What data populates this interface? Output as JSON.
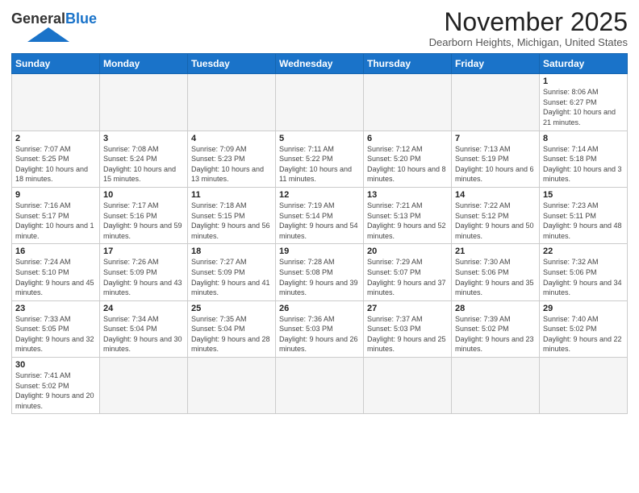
{
  "logo": {
    "general": "General",
    "blue": "Blue"
  },
  "title": "November 2025",
  "location": "Dearborn Heights, Michigan, United States",
  "weekdays": [
    "Sunday",
    "Monday",
    "Tuesday",
    "Wednesday",
    "Thursday",
    "Friday",
    "Saturday"
  ],
  "weeks": [
    [
      {
        "day": "",
        "info": ""
      },
      {
        "day": "",
        "info": ""
      },
      {
        "day": "",
        "info": ""
      },
      {
        "day": "",
        "info": ""
      },
      {
        "day": "",
        "info": ""
      },
      {
        "day": "",
        "info": ""
      },
      {
        "day": "1",
        "info": "Sunrise: 8:06 AM\nSunset: 6:27 PM\nDaylight: 10 hours and 21 minutes."
      }
    ],
    [
      {
        "day": "2",
        "info": "Sunrise: 7:07 AM\nSunset: 5:25 PM\nDaylight: 10 hours and 18 minutes."
      },
      {
        "day": "3",
        "info": "Sunrise: 7:08 AM\nSunset: 5:24 PM\nDaylight: 10 hours and 15 minutes."
      },
      {
        "day": "4",
        "info": "Sunrise: 7:09 AM\nSunset: 5:23 PM\nDaylight: 10 hours and 13 minutes."
      },
      {
        "day": "5",
        "info": "Sunrise: 7:11 AM\nSunset: 5:22 PM\nDaylight: 10 hours and 11 minutes."
      },
      {
        "day": "6",
        "info": "Sunrise: 7:12 AM\nSunset: 5:20 PM\nDaylight: 10 hours and 8 minutes."
      },
      {
        "day": "7",
        "info": "Sunrise: 7:13 AM\nSunset: 5:19 PM\nDaylight: 10 hours and 6 minutes."
      },
      {
        "day": "8",
        "info": "Sunrise: 7:14 AM\nSunset: 5:18 PM\nDaylight: 10 hours and 3 minutes."
      }
    ],
    [
      {
        "day": "9",
        "info": "Sunrise: 7:16 AM\nSunset: 5:17 PM\nDaylight: 10 hours and 1 minute."
      },
      {
        "day": "10",
        "info": "Sunrise: 7:17 AM\nSunset: 5:16 PM\nDaylight: 9 hours and 59 minutes."
      },
      {
        "day": "11",
        "info": "Sunrise: 7:18 AM\nSunset: 5:15 PM\nDaylight: 9 hours and 56 minutes."
      },
      {
        "day": "12",
        "info": "Sunrise: 7:19 AM\nSunset: 5:14 PM\nDaylight: 9 hours and 54 minutes."
      },
      {
        "day": "13",
        "info": "Sunrise: 7:21 AM\nSunset: 5:13 PM\nDaylight: 9 hours and 52 minutes."
      },
      {
        "day": "14",
        "info": "Sunrise: 7:22 AM\nSunset: 5:12 PM\nDaylight: 9 hours and 50 minutes."
      },
      {
        "day": "15",
        "info": "Sunrise: 7:23 AM\nSunset: 5:11 PM\nDaylight: 9 hours and 48 minutes."
      }
    ],
    [
      {
        "day": "16",
        "info": "Sunrise: 7:24 AM\nSunset: 5:10 PM\nDaylight: 9 hours and 45 minutes."
      },
      {
        "day": "17",
        "info": "Sunrise: 7:26 AM\nSunset: 5:09 PM\nDaylight: 9 hours and 43 minutes."
      },
      {
        "day": "18",
        "info": "Sunrise: 7:27 AM\nSunset: 5:09 PM\nDaylight: 9 hours and 41 minutes."
      },
      {
        "day": "19",
        "info": "Sunrise: 7:28 AM\nSunset: 5:08 PM\nDaylight: 9 hours and 39 minutes."
      },
      {
        "day": "20",
        "info": "Sunrise: 7:29 AM\nSunset: 5:07 PM\nDaylight: 9 hours and 37 minutes."
      },
      {
        "day": "21",
        "info": "Sunrise: 7:30 AM\nSunset: 5:06 PM\nDaylight: 9 hours and 35 minutes."
      },
      {
        "day": "22",
        "info": "Sunrise: 7:32 AM\nSunset: 5:06 PM\nDaylight: 9 hours and 34 minutes."
      }
    ],
    [
      {
        "day": "23",
        "info": "Sunrise: 7:33 AM\nSunset: 5:05 PM\nDaylight: 9 hours and 32 minutes."
      },
      {
        "day": "24",
        "info": "Sunrise: 7:34 AM\nSunset: 5:04 PM\nDaylight: 9 hours and 30 minutes."
      },
      {
        "day": "25",
        "info": "Sunrise: 7:35 AM\nSunset: 5:04 PM\nDaylight: 9 hours and 28 minutes."
      },
      {
        "day": "26",
        "info": "Sunrise: 7:36 AM\nSunset: 5:03 PM\nDaylight: 9 hours and 26 minutes."
      },
      {
        "day": "27",
        "info": "Sunrise: 7:37 AM\nSunset: 5:03 PM\nDaylight: 9 hours and 25 minutes."
      },
      {
        "day": "28",
        "info": "Sunrise: 7:39 AM\nSunset: 5:02 PM\nDaylight: 9 hours and 23 minutes."
      },
      {
        "day": "29",
        "info": "Sunrise: 7:40 AM\nSunset: 5:02 PM\nDaylight: 9 hours and 22 minutes."
      }
    ],
    [
      {
        "day": "30",
        "info": "Sunrise: 7:41 AM\nSunset: 5:02 PM\nDaylight: 9 hours and 20 minutes."
      },
      {
        "day": "",
        "info": ""
      },
      {
        "day": "",
        "info": ""
      },
      {
        "day": "",
        "info": ""
      },
      {
        "day": "",
        "info": ""
      },
      {
        "day": "",
        "info": ""
      },
      {
        "day": "",
        "info": ""
      }
    ]
  ]
}
